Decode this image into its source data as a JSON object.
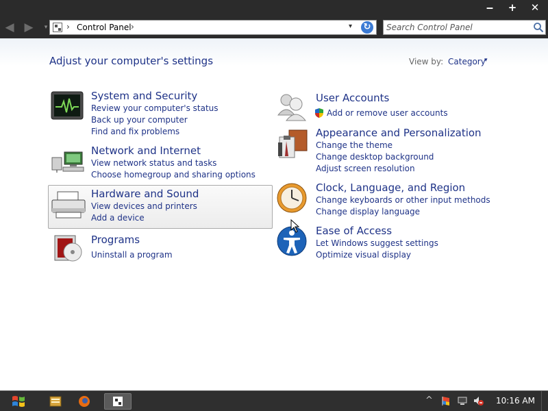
{
  "window": {
    "min": "‒",
    "max": "+",
    "close": "✕"
  },
  "nav": {
    "back": "◀",
    "forward": "▶",
    "recent": "▾",
    "sep1": "›",
    "breadcrumb": "Control Panel",
    "sep2": "›",
    "dropdown": "▾",
    "refresh": "↻"
  },
  "search": {
    "placeholder": "Search Control Panel"
  },
  "main": {
    "title": "Adjust your computer's settings",
    "viewby_label": "View by:",
    "viewby_value": "Category",
    "viewby_chev": "▾"
  },
  "categories": {
    "system": {
      "title": "System and Security",
      "links": [
        "Review your computer's status",
        "Back up your computer",
        "Find and fix problems"
      ]
    },
    "network": {
      "title": "Network and Internet",
      "links": [
        "View network status and tasks",
        "Choose homegroup and sharing options"
      ]
    },
    "hardware": {
      "title": "Hardware and Sound",
      "links": [
        "View devices and printers",
        "Add a device"
      ]
    },
    "programs": {
      "title": "Programs",
      "links": [
        "Uninstall a program"
      ]
    },
    "users": {
      "title": "User Accounts",
      "links": [
        "Add or remove user accounts"
      ]
    },
    "appearance": {
      "title": "Appearance and Personalization",
      "links": [
        "Change the theme",
        "Change desktop background",
        "Adjust screen resolution"
      ]
    },
    "clock": {
      "title": "Clock, Language, and Region",
      "links": [
        "Change keyboards or other input methods",
        "Change display language"
      ]
    },
    "ease": {
      "title": "Ease of Access",
      "links": [
        "Let Windows suggest settings",
        "Optimize visual display"
      ]
    }
  },
  "taskbar": {
    "tray_arrow": "^",
    "clock": "10:16 AM"
  },
  "colors": {
    "link": "#1e3287",
    "chrome": "#2b2b2b",
    "taskbar": "#2f2f2f"
  }
}
